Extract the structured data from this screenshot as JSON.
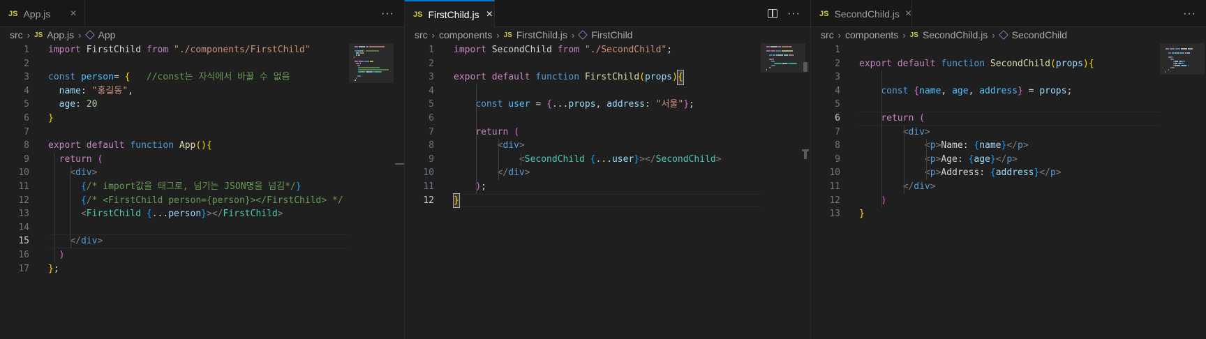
{
  "editors": [
    {
      "tab": {
        "label": "App.js",
        "badge": "JS",
        "close": "×",
        "active": false
      },
      "actions": {
        "more": "···"
      },
      "breadcrumb": {
        "items": [
          "src",
          "App.js",
          "App"
        ]
      },
      "active_line": 15,
      "lines": [
        {
          "n": "1",
          "t": [
            [
              "k",
              "import "
            ],
            [
              "w",
              "FirstChild "
            ],
            [
              "k",
              "from "
            ],
            [
              "s",
              "\"./components/FirstChild\""
            ]
          ]
        },
        {
          "n": "2",
          "t": []
        },
        {
          "n": "3",
          "t": [
            [
              "kb",
              "const "
            ],
            [
              "cn",
              "person"
            ],
            [
              "w",
              "= "
            ],
            [
              "y",
              "{"
            ],
            [
              "w",
              "   "
            ],
            [
              "c",
              "//const는 자식에서 바꿀 수 없음"
            ]
          ]
        },
        {
          "n": "4",
          "t": [
            [
              "w",
              "  "
            ],
            [
              "v",
              "name"
            ],
            [
              "w",
              ": "
            ],
            [
              "s",
              "\"홍길동\""
            ],
            [
              "w",
              ","
            ]
          ]
        },
        {
          "n": "5",
          "t": [
            [
              "w",
              "  "
            ],
            [
              "v",
              "age"
            ],
            [
              "w",
              ": "
            ],
            [
              "n",
              "20"
            ]
          ]
        },
        {
          "n": "6",
          "t": [
            [
              "y",
              "}"
            ]
          ]
        },
        {
          "n": "7",
          "t": []
        },
        {
          "n": "8",
          "t": [
            [
              "k",
              "export "
            ],
            [
              "k",
              "default "
            ],
            [
              "kb",
              "function "
            ],
            [
              "f",
              "App"
            ],
            [
              "y",
              "()"
            ],
            [
              "y",
              "{"
            ]
          ]
        },
        {
          "n": "9",
          "t": [
            [
              "w",
              "  "
            ],
            [
              "k",
              "return "
            ],
            [
              "p",
              "("
            ]
          ]
        },
        {
          "n": "10",
          "t": [
            [
              "w",
              "    "
            ],
            [
              "t",
              "<"
            ],
            [
              "tag",
              "div"
            ],
            [
              "t",
              ">"
            ]
          ]
        },
        {
          "n": "11",
          "t": [
            [
              "w",
              "      "
            ],
            [
              "b",
              "{"
            ],
            [
              "c",
              "/* import값을 태그로, 넘기는 JSON명을 넘김*/"
            ],
            [
              "b",
              "}"
            ]
          ]
        },
        {
          "n": "12",
          "t": [
            [
              "w",
              "      "
            ],
            [
              "b",
              "{"
            ],
            [
              "c",
              "/* <FirstChild person={person}></FirstChild> */"
            ]
          ]
        },
        {
          "n": "13",
          "t": [
            [
              "w",
              "      "
            ],
            [
              "t",
              "<"
            ],
            [
              "comp",
              "FirstChild "
            ],
            [
              "b",
              "{"
            ],
            [
              "w",
              "..."
            ],
            [
              "v",
              "person"
            ],
            [
              "b",
              "}"
            ],
            [
              "t",
              "></"
            ],
            [
              "comp",
              "FirstChild"
            ],
            [
              "t",
              ">"
            ]
          ]
        },
        {
          "n": "14",
          "t": []
        },
        {
          "n": "15",
          "t": [
            [
              "w",
              "    "
            ],
            [
              "t",
              "</"
            ],
            [
              "tag",
              "div"
            ],
            [
              "t",
              ">"
            ]
          ]
        },
        {
          "n": "16",
          "t": [
            [
              "w",
              "  "
            ],
            [
              "p",
              ")"
            ]
          ]
        },
        {
          "n": "17",
          "t": [
            [
              "y",
              "}"
            ],
            [
              "w",
              ";"
            ]
          ]
        }
      ]
    },
    {
      "tab": {
        "label": "FirstChild.js",
        "badge": "JS",
        "close": "×",
        "active": true
      },
      "actions": {
        "more": "···"
      },
      "breadcrumb": {
        "items": [
          "src",
          "components",
          "FirstChild.js",
          "FirstChild"
        ]
      },
      "active_line": 12,
      "lines": [
        {
          "n": "1",
          "t": [
            [
              "k",
              "import "
            ],
            [
              "w",
              "SecondChild "
            ],
            [
              "k",
              "from "
            ],
            [
              "s",
              "\"./SecondChild\""
            ],
            [
              "w",
              ";"
            ]
          ]
        },
        {
          "n": "2",
          "t": []
        },
        {
          "n": "3",
          "t": [
            [
              "k",
              "export "
            ],
            [
              "k",
              "default "
            ],
            [
              "kb",
              "function "
            ],
            [
              "f",
              "FirstChild"
            ],
            [
              "y",
              "("
            ],
            [
              "v",
              "props"
            ],
            [
              "y",
              ")"
            ],
            [
              "y",
              "{"
            ]
          ]
        },
        {
          "n": "4",
          "t": []
        },
        {
          "n": "5",
          "t": [
            [
              "w",
              "    "
            ],
            [
              "kb",
              "const "
            ],
            [
              "cn",
              "user"
            ],
            [
              "w",
              " = "
            ],
            [
              "p",
              "{"
            ],
            [
              "w",
              "..."
            ],
            [
              "v",
              "props"
            ],
            [
              "w",
              ", "
            ],
            [
              "v",
              "address"
            ],
            [
              "w",
              ": "
            ],
            [
              "s",
              "\"서울\""
            ],
            [
              "p",
              "}"
            ],
            [
              "w",
              ";"
            ]
          ]
        },
        {
          "n": "6",
          "t": []
        },
        {
          "n": "7",
          "t": [
            [
              "w",
              "    "
            ],
            [
              "k",
              "return "
            ],
            [
              "p",
              "("
            ]
          ]
        },
        {
          "n": "8",
          "t": [
            [
              "w",
              "        "
            ],
            [
              "t",
              "<"
            ],
            [
              "tag",
              "div"
            ],
            [
              "t",
              ">"
            ]
          ]
        },
        {
          "n": "9",
          "t": [
            [
              "w",
              "            "
            ],
            [
              "t",
              "<"
            ],
            [
              "comp",
              "SecondChild "
            ],
            [
              "b",
              "{"
            ],
            [
              "w",
              "..."
            ],
            [
              "v",
              "user"
            ],
            [
              "b",
              "}"
            ],
            [
              "t",
              "></"
            ],
            [
              "comp",
              "SecondChild"
            ],
            [
              "t",
              ">"
            ]
          ]
        },
        {
          "n": "10",
          "t": [
            [
              "w",
              "        "
            ],
            [
              "t",
              "</"
            ],
            [
              "tag",
              "div"
            ],
            [
              "t",
              ">"
            ]
          ]
        },
        {
          "n": "11",
          "t": [
            [
              "w",
              "    "
            ],
            [
              "p",
              ")"
            ],
            [
              "w",
              ";"
            ]
          ]
        },
        {
          "n": "12",
          "t": [
            [
              "y",
              "}"
            ]
          ]
        }
      ]
    },
    {
      "tab": {
        "label": "SecondChild.js",
        "badge": "JS",
        "close": "×",
        "active": false
      },
      "actions": {
        "more": "···"
      },
      "breadcrumb": {
        "items": [
          "src",
          "components",
          "SecondChild.js",
          "SecondChild"
        ]
      },
      "active_line": 6,
      "lines": [
        {
          "n": "1",
          "t": []
        },
        {
          "n": "2",
          "t": [
            [
              "k",
              "export "
            ],
            [
              "k",
              "default "
            ],
            [
              "kb",
              "function "
            ],
            [
              "f",
              "SecondChild"
            ],
            [
              "y",
              "("
            ],
            [
              "v",
              "props"
            ],
            [
              "y",
              ")"
            ],
            [
              "y",
              "{"
            ]
          ]
        },
        {
          "n": "3",
          "t": []
        },
        {
          "n": "4",
          "t": [
            [
              "w",
              "    "
            ],
            [
              "kb",
              "const "
            ],
            [
              "p",
              "{"
            ],
            [
              "cn",
              "name"
            ],
            [
              "w",
              ", "
            ],
            [
              "cn",
              "age"
            ],
            [
              "w",
              ", "
            ],
            [
              "cn",
              "address"
            ],
            [
              "p",
              "}"
            ],
            [
              "w",
              " = "
            ],
            [
              "v",
              "props"
            ],
            [
              "w",
              ";"
            ]
          ]
        },
        {
          "n": "5",
          "t": []
        },
        {
          "n": "6",
          "t": [
            [
              "w",
              "    "
            ],
            [
              "k",
              "return "
            ],
            [
              "p",
              "("
            ]
          ]
        },
        {
          "n": "7",
          "t": [
            [
              "w",
              "        "
            ],
            [
              "t",
              "<"
            ],
            [
              "tag",
              "div"
            ],
            [
              "t",
              ">"
            ]
          ]
        },
        {
          "n": "8",
          "t": [
            [
              "w",
              "            "
            ],
            [
              "t",
              "<"
            ],
            [
              "tag",
              "p"
            ],
            [
              "t",
              ">"
            ],
            [
              "w",
              "Name: "
            ],
            [
              "b",
              "{"
            ],
            [
              "v",
              "name"
            ],
            [
              "b",
              "}"
            ],
            [
              "t",
              "</"
            ],
            [
              "tag",
              "p"
            ],
            [
              "t",
              ">"
            ]
          ]
        },
        {
          "n": "9",
          "t": [
            [
              "w",
              "            "
            ],
            [
              "t",
              "<"
            ],
            [
              "tag",
              "p"
            ],
            [
              "t",
              ">"
            ],
            [
              "w",
              "Age: "
            ],
            [
              "b",
              "{"
            ],
            [
              "v",
              "age"
            ],
            [
              "b",
              "}"
            ],
            [
              "t",
              "</"
            ],
            [
              "tag",
              "p"
            ],
            [
              "t",
              ">"
            ]
          ]
        },
        {
          "n": "10",
          "t": [
            [
              "w",
              "            "
            ],
            [
              "t",
              "<"
            ],
            [
              "tag",
              "p"
            ],
            [
              "t",
              ">"
            ],
            [
              "w",
              "Address: "
            ],
            [
              "b",
              "{"
            ],
            [
              "v",
              "address"
            ],
            [
              "b",
              "}"
            ],
            [
              "t",
              "</"
            ],
            [
              "tag",
              "p"
            ],
            [
              "t",
              ">"
            ]
          ]
        },
        {
          "n": "11",
          "t": [
            [
              "w",
              "        "
            ],
            [
              "t",
              "</"
            ],
            [
              "tag",
              "div"
            ],
            [
              "t",
              ">"
            ]
          ]
        },
        {
          "n": "12",
          "t": [
            [
              "w",
              "    "
            ],
            [
              "p",
              ")"
            ]
          ]
        },
        {
          "n": "13",
          "t": [
            [
              "y",
              "}"
            ]
          ]
        }
      ]
    }
  ]
}
